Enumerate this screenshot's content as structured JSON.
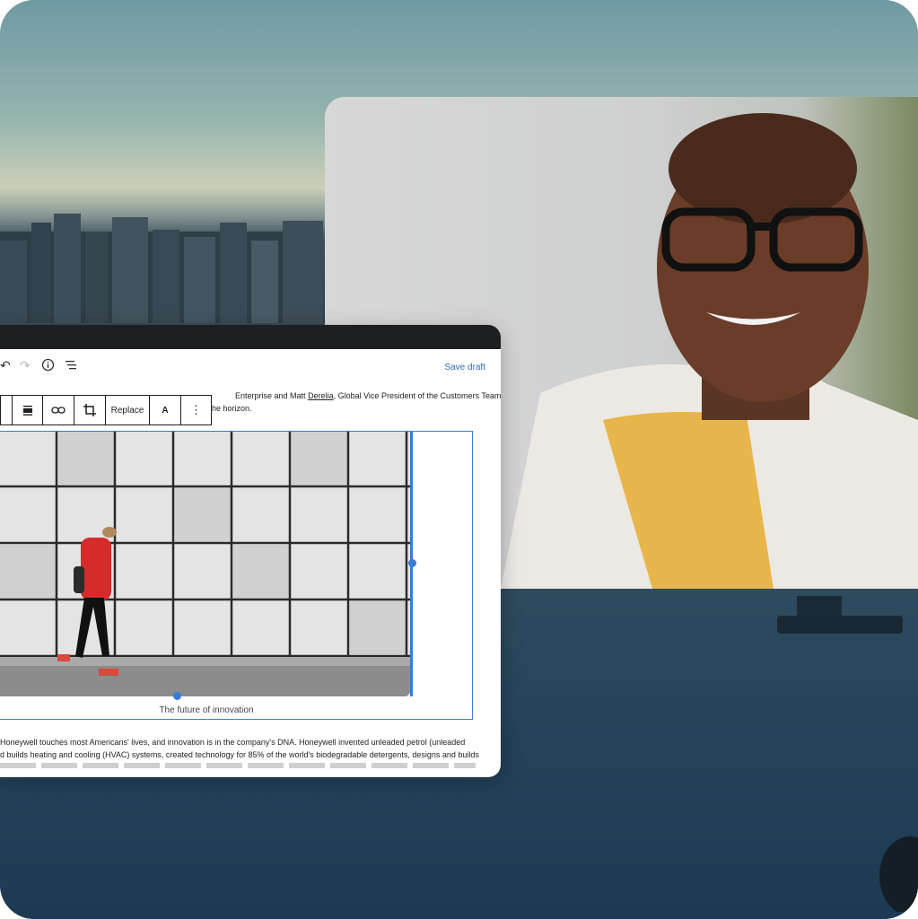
{
  "editor": {
    "save_draft": "Save draft",
    "intro_text_a": "Enterprise and Matt",
    "intro_name": "Derelia",
    "intro_text_b": ", Global Vice President of the Customers Team",
    "intro_line2": "he horizon.",
    "block_toolbar": {
      "replace_label": "Replace",
      "text_label": "A",
      "more_label": "⋮"
    },
    "image": {
      "caption": "The future of innovation"
    },
    "para_line1": "Honeywell touches most Americans' lives, and innovation is in the company's DNA. Honeywell invented unleaded petrol (unleaded",
    "para_line2": "d builds heating and cooling (HVAC) systems, created technology for 85% of the world's biodegradable detergents, designs and builds"
  },
  "icons": {
    "undo": "undo-icon",
    "redo": "redo-icon",
    "info": "info-icon",
    "list_view": "list-view-icon",
    "align": "align-icon",
    "link": "link-icon",
    "crop": "crop-icon"
  },
  "colors": {
    "accent": "#3a7bd5",
    "save_link": "#2f6db8",
    "editor_header": "#1e1f22"
  }
}
